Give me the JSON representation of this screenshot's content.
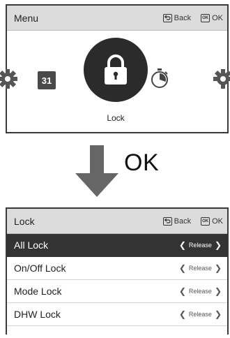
{
  "menu_screen": {
    "title": "Menu",
    "hint_back": "Back",
    "hint_ok": "OK",
    "key_back_glyph": "⮌",
    "key_ok_glyph": "OK",
    "calendar_day": "31",
    "selected_label": "Lock",
    "icons": [
      "gear-icon",
      "calendar-icon",
      "lock-icon",
      "timer-icon",
      "gear-icon"
    ]
  },
  "transition": {
    "ok_text": "OK"
  },
  "lock_screen": {
    "title": "Lock",
    "hint_back": "Back",
    "hint_ok": "OK",
    "key_back_glyph": "⮌",
    "key_ok_glyph": "OK",
    "items": [
      {
        "label": "All Lock",
        "value": "Release"
      },
      {
        "label": "On/Off Lock",
        "value": "Release"
      },
      {
        "label": "Mode Lock",
        "value": "Release"
      },
      {
        "label": "DHW Lock",
        "value": "Release"
      }
    ],
    "selected_index": 0
  },
  "colors": {
    "titlebar": "#dcdcdc",
    "selected_row": "#333333",
    "icon_dark": "#2b2b2b",
    "arrow": "#666666"
  }
}
